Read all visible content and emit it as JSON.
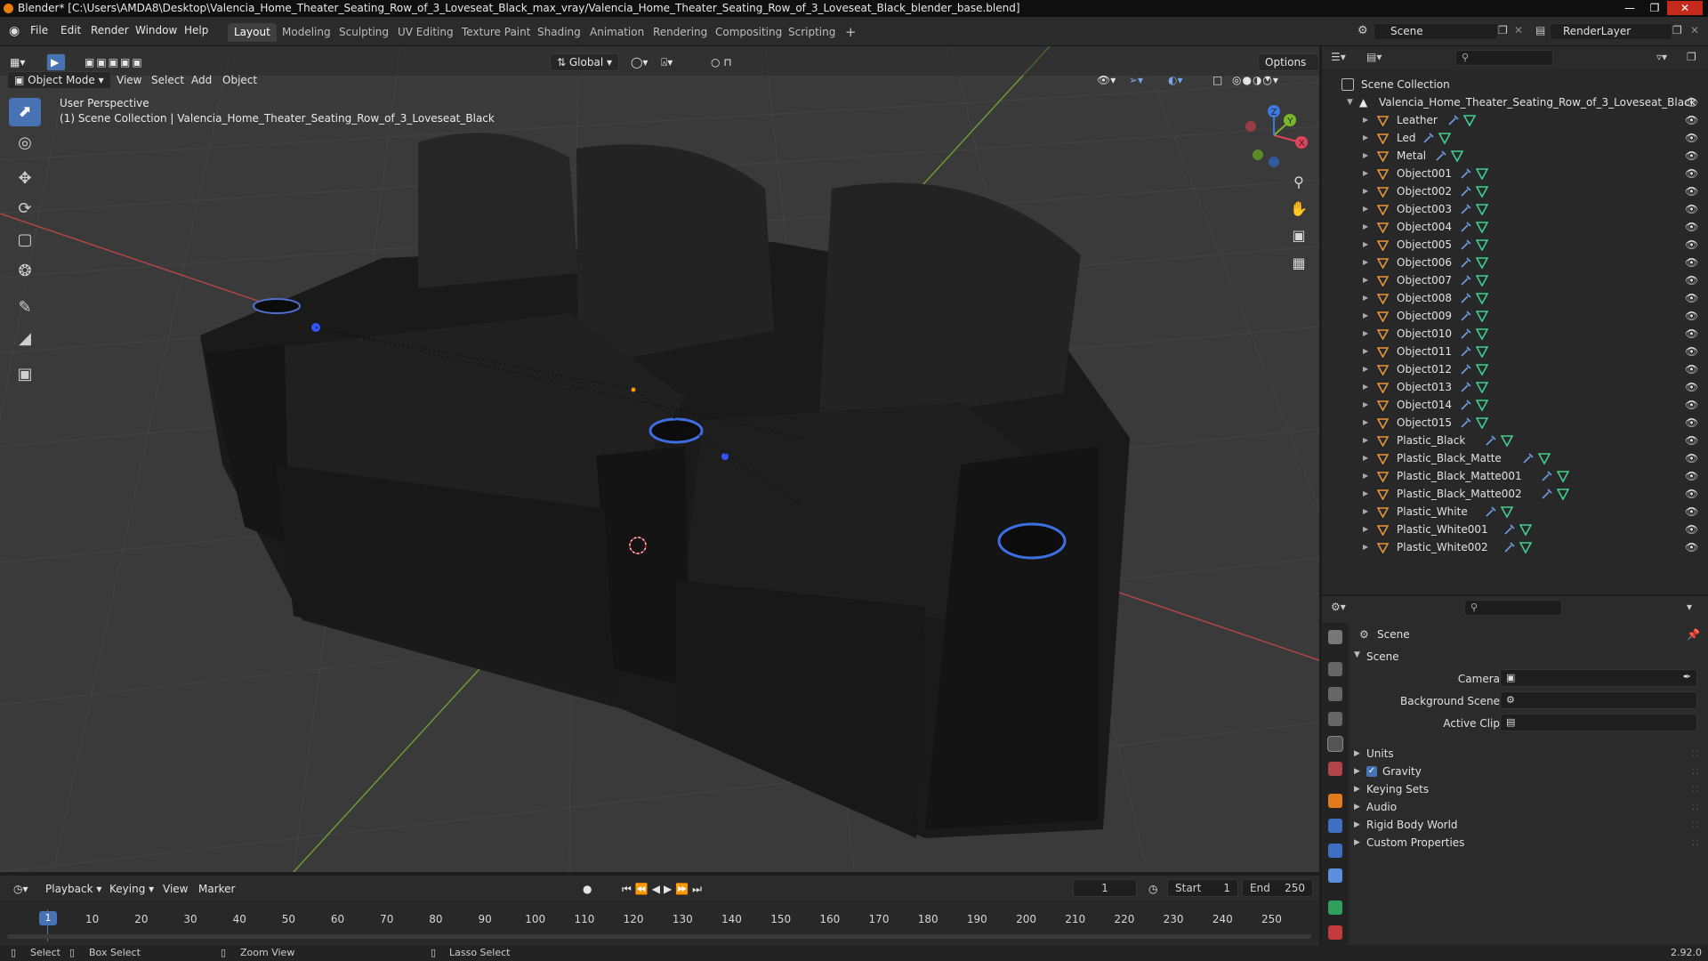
{
  "window": {
    "title": "Blender* [C:\\Users\\AMDA8\\Desktop\\Valencia_Home_Theater_Seating_Row_of_3_Loveseat_Black_max_vray/Valencia_Home_Theater_Seating_Row_of_3_Loveseat_Black_blender_base.blend]",
    "accent": "#4772b3"
  },
  "menu": [
    "File",
    "Edit",
    "Render",
    "Window",
    "Help"
  ],
  "workspaces": [
    "Layout",
    "Modeling",
    "Sculpting",
    "UV Editing",
    "Texture Paint",
    "Shading",
    "Animation",
    "Rendering",
    "Compositing",
    "Scripting",
    "+"
  ],
  "active_workspace": "Layout",
  "top_right": {
    "scene": "Scene",
    "view_layer": "RenderLayer"
  },
  "viewport": {
    "mode": "Object Mode",
    "menus": [
      "View",
      "Select",
      "Add",
      "Object"
    ],
    "orientation": "Global",
    "options": "Options",
    "perspective_label": "User Perspective",
    "collection_label": "(1) Scene Collection | Valencia_Home_Theater_Seating_Row_of_3_Loveseat_Black",
    "gizmo": {
      "x": "X",
      "y": "Y",
      "z": "Z"
    }
  },
  "outliner": {
    "root": "Scene Collection",
    "collection": "Valencia_Home_Theater_Seating_Row_of_3_Loveseat_Black",
    "objects": [
      "Leather",
      "Led",
      "Metal",
      "Object001",
      "Object002",
      "Object003",
      "Object004",
      "Object005",
      "Object006",
      "Object007",
      "Object008",
      "Object009",
      "Object010",
      "Object011",
      "Object012",
      "Object013",
      "Object014",
      "Object015",
      "Plastic_Black",
      "Plastic_Black_Matte",
      "Plastic_Black_Matte001",
      "Plastic_Black_Matte002",
      "Plastic_White",
      "Plastic_White001",
      "Plastic_White002"
    ]
  },
  "properties": {
    "header": "Scene",
    "panel": "Scene",
    "camera_label": "Camera",
    "background_label": "Background Scene",
    "clip_label": "Active Clip",
    "sections": [
      "Units",
      "Gravity",
      "Keying Sets",
      "Audio",
      "Rigid Body World",
      "Custom Properties"
    ],
    "gravity_checked": true
  },
  "timeline": {
    "menus": [
      "Playback",
      "Keying",
      "View",
      "Marker"
    ],
    "current_frame": "1",
    "start_label": "Start",
    "start": "1",
    "end_label": "End",
    "end": "250",
    "ticks": [
      "1",
      "10",
      "20",
      "30",
      "40",
      "50",
      "60",
      "70",
      "80",
      "90",
      "100",
      "110",
      "120",
      "130",
      "140",
      "150",
      "160",
      "170",
      "180",
      "190",
      "200",
      "210",
      "220",
      "230",
      "240",
      "250"
    ]
  },
  "statusbar": {
    "select": "Select",
    "box_select": "Box Select",
    "zoom_view": "Zoom View",
    "lasso_select": "Lasso Select",
    "version": "2.92.0"
  }
}
